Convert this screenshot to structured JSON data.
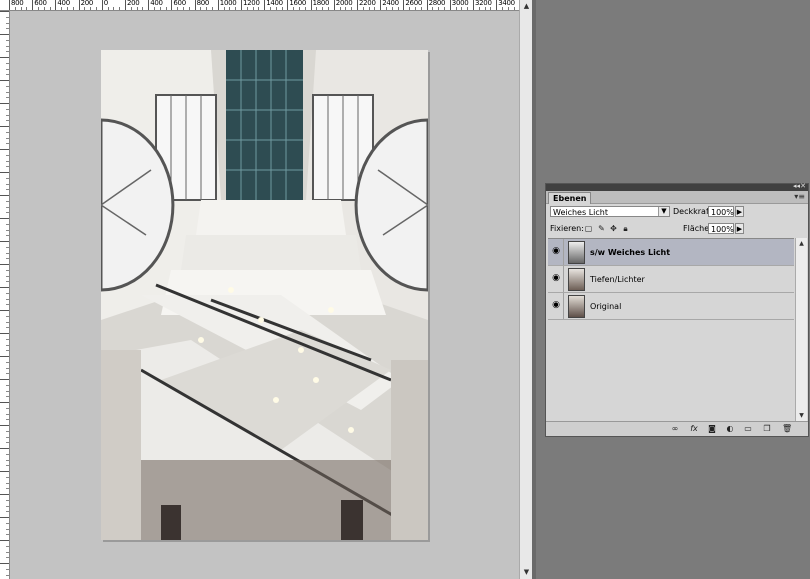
{
  "ruler": {
    "labels": [
      "800",
      "600",
      "400",
      "200",
      "0",
      "200",
      "400",
      "600",
      "800",
      "1000",
      "1200",
      "1400",
      "1600",
      "1800",
      "2000",
      "2200",
      "2400",
      "2600",
      "2800",
      "3000",
      "3200",
      "3400"
    ]
  },
  "layers_panel": {
    "tab": "Ebenen",
    "blend_mode": "Weiches Licht",
    "opacity_label": "Deckkraft:",
    "opacity_value": "100%",
    "lock_label": "Fixieren:",
    "fill_label": "Fläche:",
    "fill_value": "100%",
    "layers": [
      {
        "name": "s/w Weiches Licht",
        "selected": true,
        "visible": true
      },
      {
        "name": "Tiefen/Lichter",
        "selected": false,
        "visible": true
      },
      {
        "name": "Original",
        "selected": false,
        "visible": true
      }
    ],
    "bottom_icons": [
      "link-icon",
      "fx-icon",
      "mask-icon",
      "adjustment-icon",
      "group-icon",
      "new-layer-icon",
      "trash-icon"
    ]
  },
  "colors": {
    "canvas_bg": "#c3c3c3",
    "app_bg": "#7b7b7b",
    "selected_layer": "#b3b6c2"
  }
}
